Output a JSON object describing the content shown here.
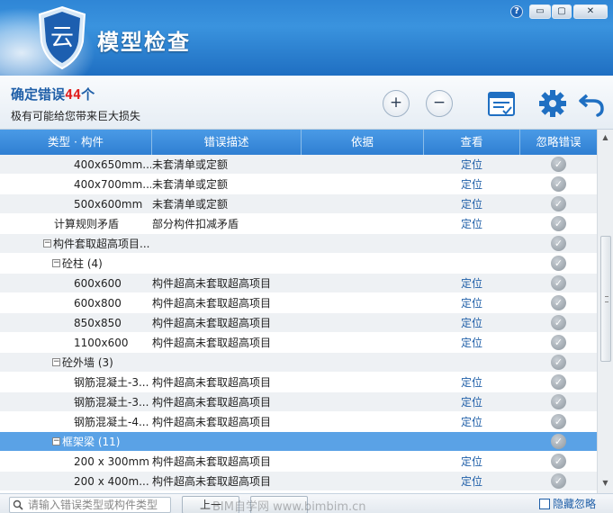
{
  "app": {
    "title": "模型检查"
  },
  "header": {
    "error_label": "确定错误",
    "error_count": "44",
    "error_unit": "个",
    "subtitle": "极有可能给您带来巨大损失"
  },
  "toolbar": {
    "expand_label": "+",
    "collapse_label": "−"
  },
  "window_controls": {
    "help": "?",
    "minimize": "▭",
    "maximize": "▢",
    "close": "✕"
  },
  "table": {
    "columns": [
      "类型 · 构件",
      "错误描述",
      "依据",
      "查看",
      "忽略错误"
    ],
    "rows": [
      {
        "name": "400x650mm...",
        "desc": "未套清单或定额",
        "loc": "定位",
        "indent": 82,
        "toggle": ""
      },
      {
        "name": "400x700mm...",
        "desc": "未套清单或定额",
        "loc": "定位",
        "indent": 82,
        "toggle": ""
      },
      {
        "name": "500x600mm",
        "desc": "未套清单或定额",
        "loc": "定位",
        "indent": 82,
        "toggle": ""
      },
      {
        "name": "计算规则矛盾",
        "desc": "部分构件扣减矛盾",
        "loc": "定位",
        "indent": 60,
        "toggle": ""
      },
      {
        "name": "构件套取超高项目...",
        "desc": "",
        "loc": "",
        "indent": 48,
        "toggle": "−"
      },
      {
        "name": "砼柱 (4)",
        "desc": "",
        "loc": "",
        "indent": 58,
        "toggle": "−"
      },
      {
        "name": "600x600",
        "desc": "构件超高未套取超高项目",
        "loc": "定位",
        "indent": 82,
        "toggle": ""
      },
      {
        "name": "600x800",
        "desc": "构件超高未套取超高项目",
        "loc": "定位",
        "indent": 82,
        "toggle": ""
      },
      {
        "name": "850x850",
        "desc": "构件超高未套取超高项目",
        "loc": "定位",
        "indent": 82,
        "toggle": ""
      },
      {
        "name": "1100x600",
        "desc": "构件超高未套取超高项目",
        "loc": "定位",
        "indent": 82,
        "toggle": ""
      },
      {
        "name": "砼外墙 (3)",
        "desc": "",
        "loc": "",
        "indent": 58,
        "toggle": "−"
      },
      {
        "name": "钢筋混凝土-3...",
        "desc": "构件超高未套取超高项目",
        "loc": "定位",
        "indent": 82,
        "toggle": ""
      },
      {
        "name": "钢筋混凝土-3...",
        "desc": "构件超高未套取超高项目",
        "loc": "定位",
        "indent": 82,
        "toggle": ""
      },
      {
        "name": "钢筋混凝土-4...",
        "desc": "构件超高未套取超高项目",
        "loc": "定位",
        "indent": 82,
        "toggle": ""
      },
      {
        "name": "框架梁 (11)",
        "desc": "",
        "loc": "",
        "indent": 58,
        "toggle": "−",
        "selected": true
      },
      {
        "name": "200 x 300mm",
        "desc": "构件超高未套取超高项目",
        "loc": "定位",
        "indent": 82,
        "toggle": ""
      },
      {
        "name": "200 x 400m...",
        "desc": "构件超高未套取超高项目",
        "loc": "定位",
        "indent": 82,
        "toggle": ""
      }
    ]
  },
  "footer": {
    "search_placeholder": "请输入错误类型或构件类型",
    "prev_label": "上一",
    "watermark": "BIM自学网 www.bimbim.cn",
    "hide_ignored_label": "隐藏忽略"
  },
  "colors": {
    "accent": "#2f7fd2",
    "selected_row": "#5aa2e6",
    "error_count": "#e02020",
    "link": "#1f5fa8"
  }
}
